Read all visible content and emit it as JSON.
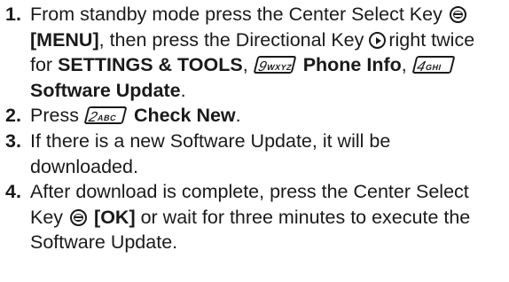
{
  "steps": [
    {
      "number": "1.",
      "text_a": "From standby mode press the Center Select Key",
      "menu_label": "[MENU]",
      "text_b": ", then press the Directional Key",
      "text_c": "right twice for",
      "settings_label": "SETTINGS & TOOLS",
      "comma1": ",",
      "key9_digit": "9",
      "key9_letters": "WXYZ",
      "phone_info_label": "Phone Info",
      "comma2": ",",
      "key4_digit": "4",
      "key4_letters": "GHI",
      "software_update_label": "Software Update",
      "period": "."
    },
    {
      "number": "2.",
      "text_a": "Press",
      "key2_digit": "2",
      "key2_letters": "ABC",
      "check_new_label": "Check New",
      "period": "."
    },
    {
      "number": "3.",
      "text": "If there is a new Software Update, it will be downloaded."
    },
    {
      "number": "4.",
      "text_a": "After download is complete, press the Center Select Key",
      "ok_label": "[OK]",
      "text_b": "or wait for three minutes to execute the Software Update."
    }
  ],
  "icons": {
    "center_select": "center-select-key-icon",
    "directional_right": "directional-right-key-icon",
    "keypad": "keypad-key-icon"
  }
}
